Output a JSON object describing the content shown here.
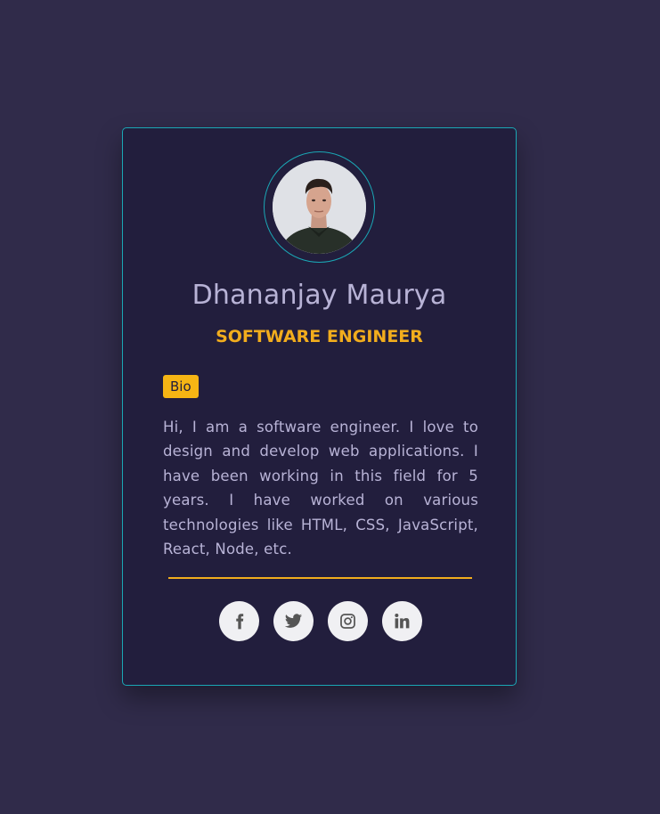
{
  "profile": {
    "name": "Dhananjay Maurya",
    "role": "SOFTWARE ENGINEER",
    "bio_label": "Bio",
    "bio_text": "Hi, I am a software engineer. I love to design and develop web applications. I have been working in this field for 5 years. I have worked on various technologies like HTML, CSS, JavaScript, React, Node, etc."
  },
  "socials": [
    {
      "icon": "facebook-icon"
    },
    {
      "icon": "twitter-icon"
    },
    {
      "icon": "instagram-icon"
    },
    {
      "icon": "linkedin-icon"
    }
  ],
  "colors": {
    "background": "#302b4a",
    "card": "#221e3d",
    "accent": "#f2ad1d",
    "border": "#1aa7b5",
    "text": "#b8b3d6"
  }
}
